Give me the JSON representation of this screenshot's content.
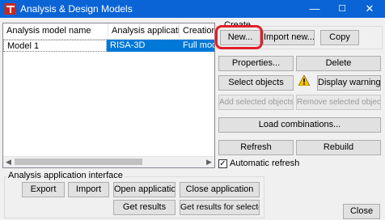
{
  "window": {
    "title": "Analysis & Design Models",
    "minimize": "—",
    "maximize": "☐",
    "close": "✕"
  },
  "table": {
    "columns": [
      "Analysis model name",
      "Analysis applicati...",
      "Creation m"
    ],
    "rows": [
      {
        "name": "Model 1",
        "application": "RISA-3D",
        "creation": "Full mode"
      }
    ]
  },
  "create_group": {
    "label": "Create",
    "new": "New...",
    "import_new": "Import new...",
    "copy": "Copy"
  },
  "buttons": {
    "properties": "Properties...",
    "delete": "Delete",
    "select_objects": "Select objects",
    "display_warnings": "Display warnings",
    "add_selected_objects": "Add selected objects",
    "remove_selected_objects": "Remove selected objects",
    "load_combinations": "Load combinations...",
    "refresh": "Refresh",
    "rebuild": "Rebuild",
    "close": "Close"
  },
  "automatic_refresh": {
    "label": "Automatic refresh",
    "checked": true
  },
  "interface_group": {
    "label": "Analysis application interface",
    "export": "Export",
    "import": "Import",
    "open_application": "Open application",
    "close_application": "Close application",
    "get_results": "Get results",
    "get_results_selected": "Get results for selected"
  },
  "icons": {
    "app_icon": "tekla-icon",
    "warning_icon": "warning-icon"
  },
  "colors": {
    "titlebar": "#0a64d6",
    "selection": "#0078d7",
    "highlight_circle": "#e0202a"
  }
}
